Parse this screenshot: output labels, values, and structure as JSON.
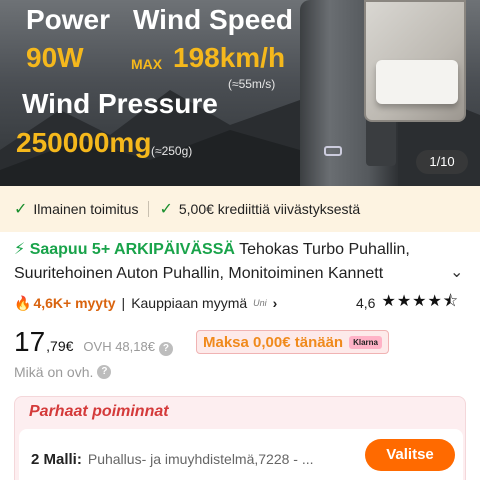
{
  "hero": {
    "power_label": "Power",
    "power_value": "90W",
    "wind_speed_label": "Wind Speed",
    "wind_speed_max": "MAX",
    "wind_speed_value": "198km/h",
    "wind_speed_sub": "(≈55m/s)",
    "wind_pressure_label": "Wind Pressure",
    "wind_pressure_value": "250000mg",
    "wind_pressure_sub": "(≈250g)",
    "image_counter": "1/10"
  },
  "perks": {
    "free_shipping": "Ilmainen toimitus",
    "credit": "5,00€ krediittiä viivästyksestä"
  },
  "product": {
    "delivery_badge": "Saapuu 5+ ARKIPÄIVÄSSÄ",
    "title_line1": "Tehokas Turbo Puhallin,",
    "title_line2": "Suuritehoinen Auton Puhallin, Monitoiminen Kannett"
  },
  "sales": {
    "sold": "4,6K+ myyty",
    "seller": "Kauppiaan myymä",
    "seller_tag": "Uni",
    "rating": "4,6",
    "stars": 4.6
  },
  "price": {
    "integer": "17",
    "decimal": ",79€",
    "old": "OVH 48,18€",
    "pay_today": "Maksa 0,00€ tänään",
    "klarna": "Klarna",
    "ovh_note": "Mikä on ovh."
  },
  "picks": {
    "title": "Parhaat poiminnat",
    "variant_label": "2 Malli:",
    "variant_value": "Puhallus- ja imuyhdistelmä,7228 - ...",
    "select_button": "Valitse"
  },
  "colors": {
    "accent_orange": "#ff6a00",
    "green": "#19a34a",
    "hero_yellow": "#f5b81c",
    "pick_red": "#d43a3a"
  }
}
